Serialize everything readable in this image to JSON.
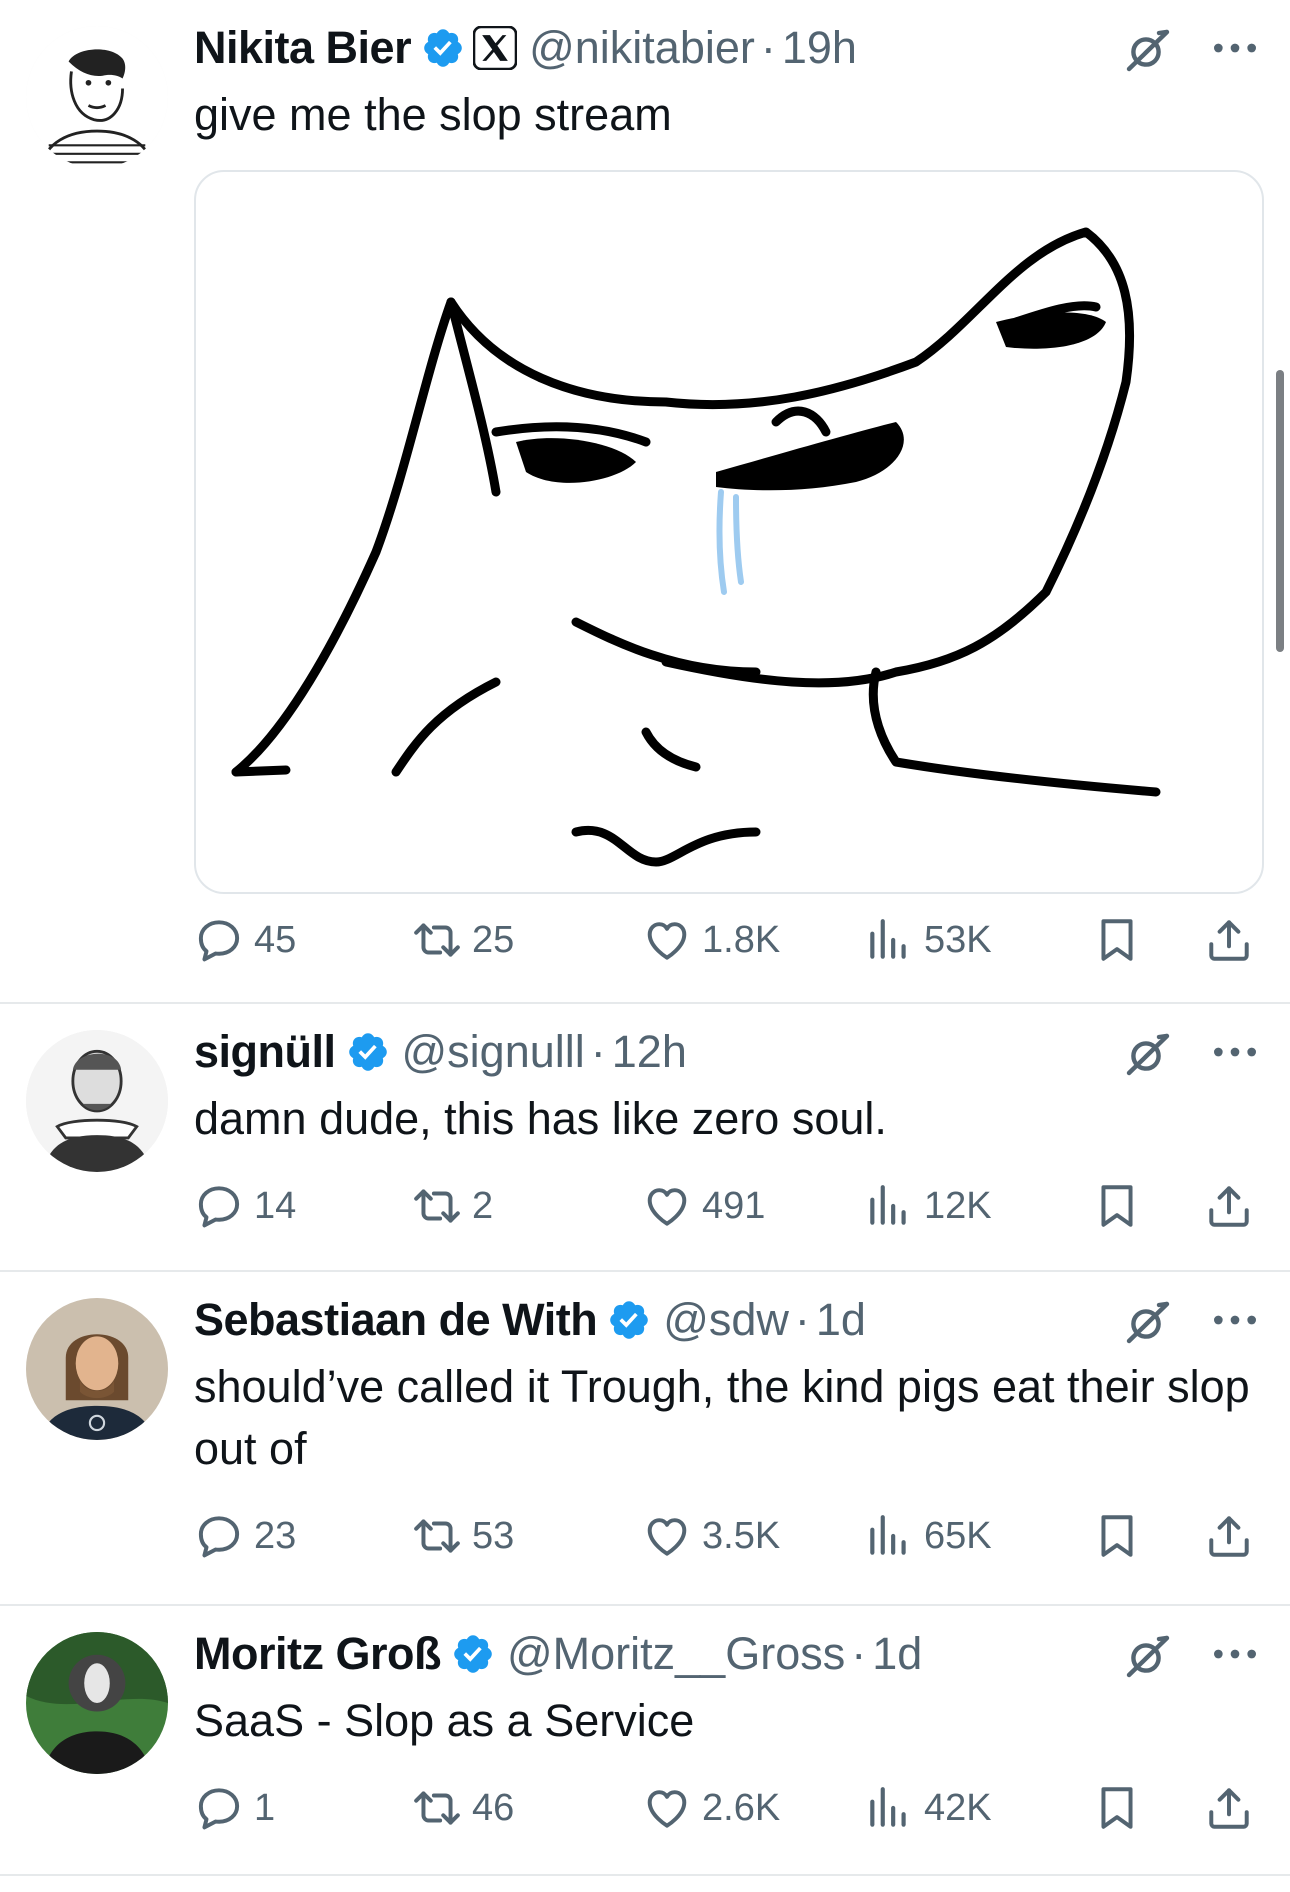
{
  "colors": {
    "verified": "#1d9bf0",
    "secondary_text": "#536471",
    "divider": "#e6e9eb"
  },
  "tweets": [
    {
      "name": "Nikita Bier",
      "handle": "@nikitabier",
      "time": "19h",
      "text": "give me the slop stream",
      "avatar": "cartoon-portrait-avatar",
      "has_affiliate_badge": true,
      "media": "wojak-meme-drawing",
      "replies": "45",
      "retweets": "25",
      "likes": "1.8K",
      "views": "53K"
    },
    {
      "name": "signüll",
      "handle": "@signulll",
      "time": "12h",
      "text": "damn dude, this has like zero soul.",
      "avatar": "shakespeare-engraving-avatar",
      "replies": "14",
      "retweets": "2",
      "likes": "491",
      "views": "12K"
    },
    {
      "name": "Sebastiaan de With",
      "handle": "@sdw",
      "time": "1d",
      "text": "should’ve called it Trough, the kind pigs eat their slop out of",
      "avatar": "photo-avatar",
      "replies": "23",
      "retweets": "53",
      "likes": "3.5K",
      "views": "65K"
    },
    {
      "name": "Moritz Groß",
      "handle": "@Moritz__Gross",
      "time": "1d",
      "text": "SaaS - Slop as a Service",
      "avatar": "masked-figure-avatar",
      "replies": "1",
      "retweets": "46",
      "likes": "2.6K",
      "views": "42K"
    }
  ],
  "separator": "·"
}
